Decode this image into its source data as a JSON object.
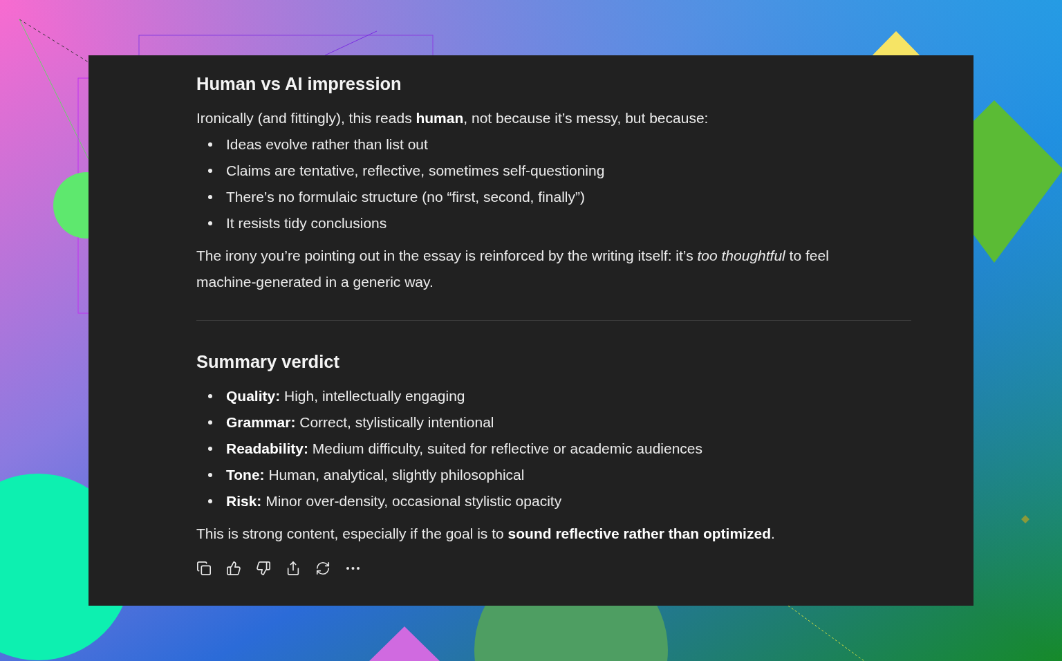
{
  "sections": [
    {
      "heading": "Human vs AI impression",
      "intro": "Ironically (and fittingly), this reads **human**, not because it’s messy, but because:",
      "bullets": [
        "Ideas evolve rather than list out",
        "Claims are tentative, reflective, sometimes self-questioning",
        "There’s no formulaic structure (no “first, second, finally”)",
        "It resists tidy conclusions"
      ],
      "outro": "The irony you’re pointing out in the essay is reinforced by the writing itself: it’s *too thoughtful* to feel machine-generated in a generic way."
    },
    {
      "heading": "Summary verdict",
      "bullets": [
        "**Quality:** High, intellectually engaging",
        "**Grammar:** Correct, stylistically intentional",
        "**Readability:** Medium difficulty, suited for reflective or academic audiences",
        "**Tone:** Human, analytical, slightly philosophical",
        "**Risk:** Minor over-density, occasional stylistic opacity"
      ],
      "outro": "This is strong content, especially if the goal is to **sound reflective rather than optimized**."
    }
  ],
  "actions": [
    {
      "kind": "copy"
    },
    {
      "kind": "like"
    },
    {
      "kind": "dislike"
    },
    {
      "kind": "share"
    },
    {
      "kind": "regenerate"
    },
    {
      "kind": "more"
    }
  ]
}
